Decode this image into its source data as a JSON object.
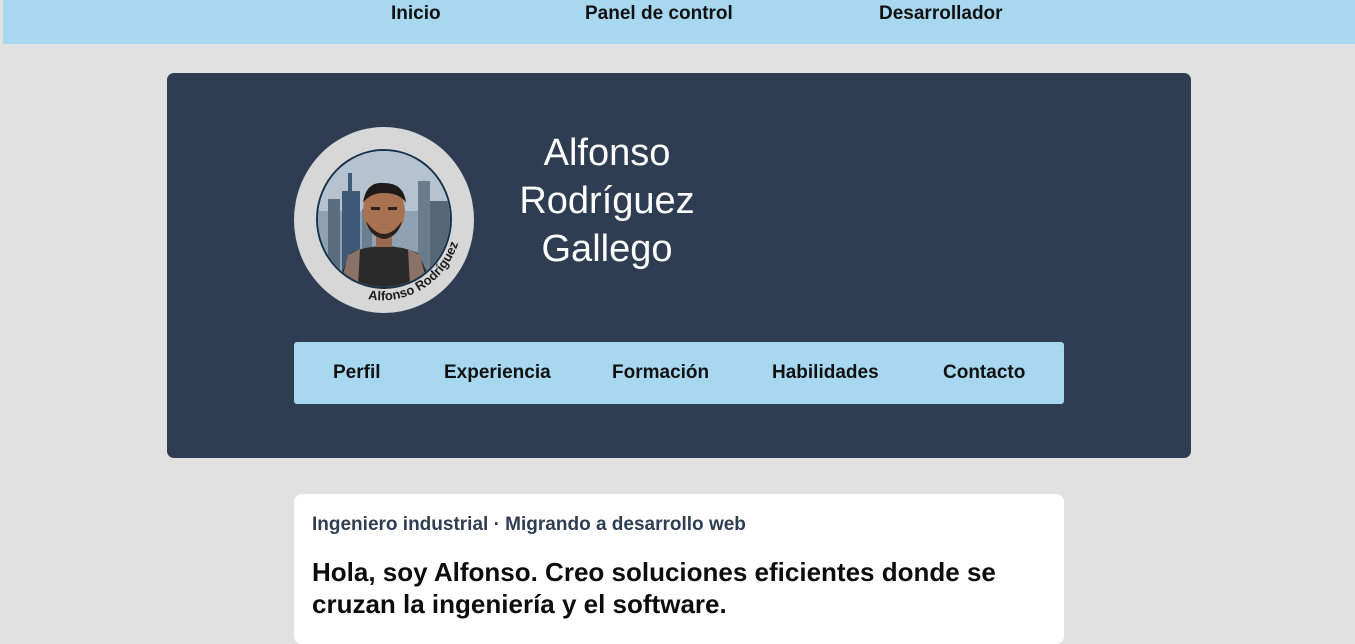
{
  "topnav": {
    "items": [
      {
        "label": "Inicio"
      },
      {
        "label": "Panel de control"
      },
      {
        "label": "Desarrollador"
      }
    ]
  },
  "header": {
    "name_lines": [
      "Alfonso",
      "Rodríguez",
      "Gallego"
    ],
    "avatar_caption": "Alfonso Rodríguez"
  },
  "section_nav": {
    "items": [
      {
        "label": "Perfil"
      },
      {
        "label": "Experiencia"
      },
      {
        "label": "Formación"
      },
      {
        "label": "Habilidades"
      },
      {
        "label": "Contacto"
      }
    ]
  },
  "intro": {
    "subtitle": "Ingeniero industrial · Migrando a desarrollo web",
    "greeting": "Hola, soy Alfonso. Creo soluciones eficientes donde se cruzan la ingeniería y el software."
  },
  "colors": {
    "topnav_bg": "#a8d8f0",
    "header_bg": "#2e3d51",
    "page_bg": "#e1e1e1"
  }
}
